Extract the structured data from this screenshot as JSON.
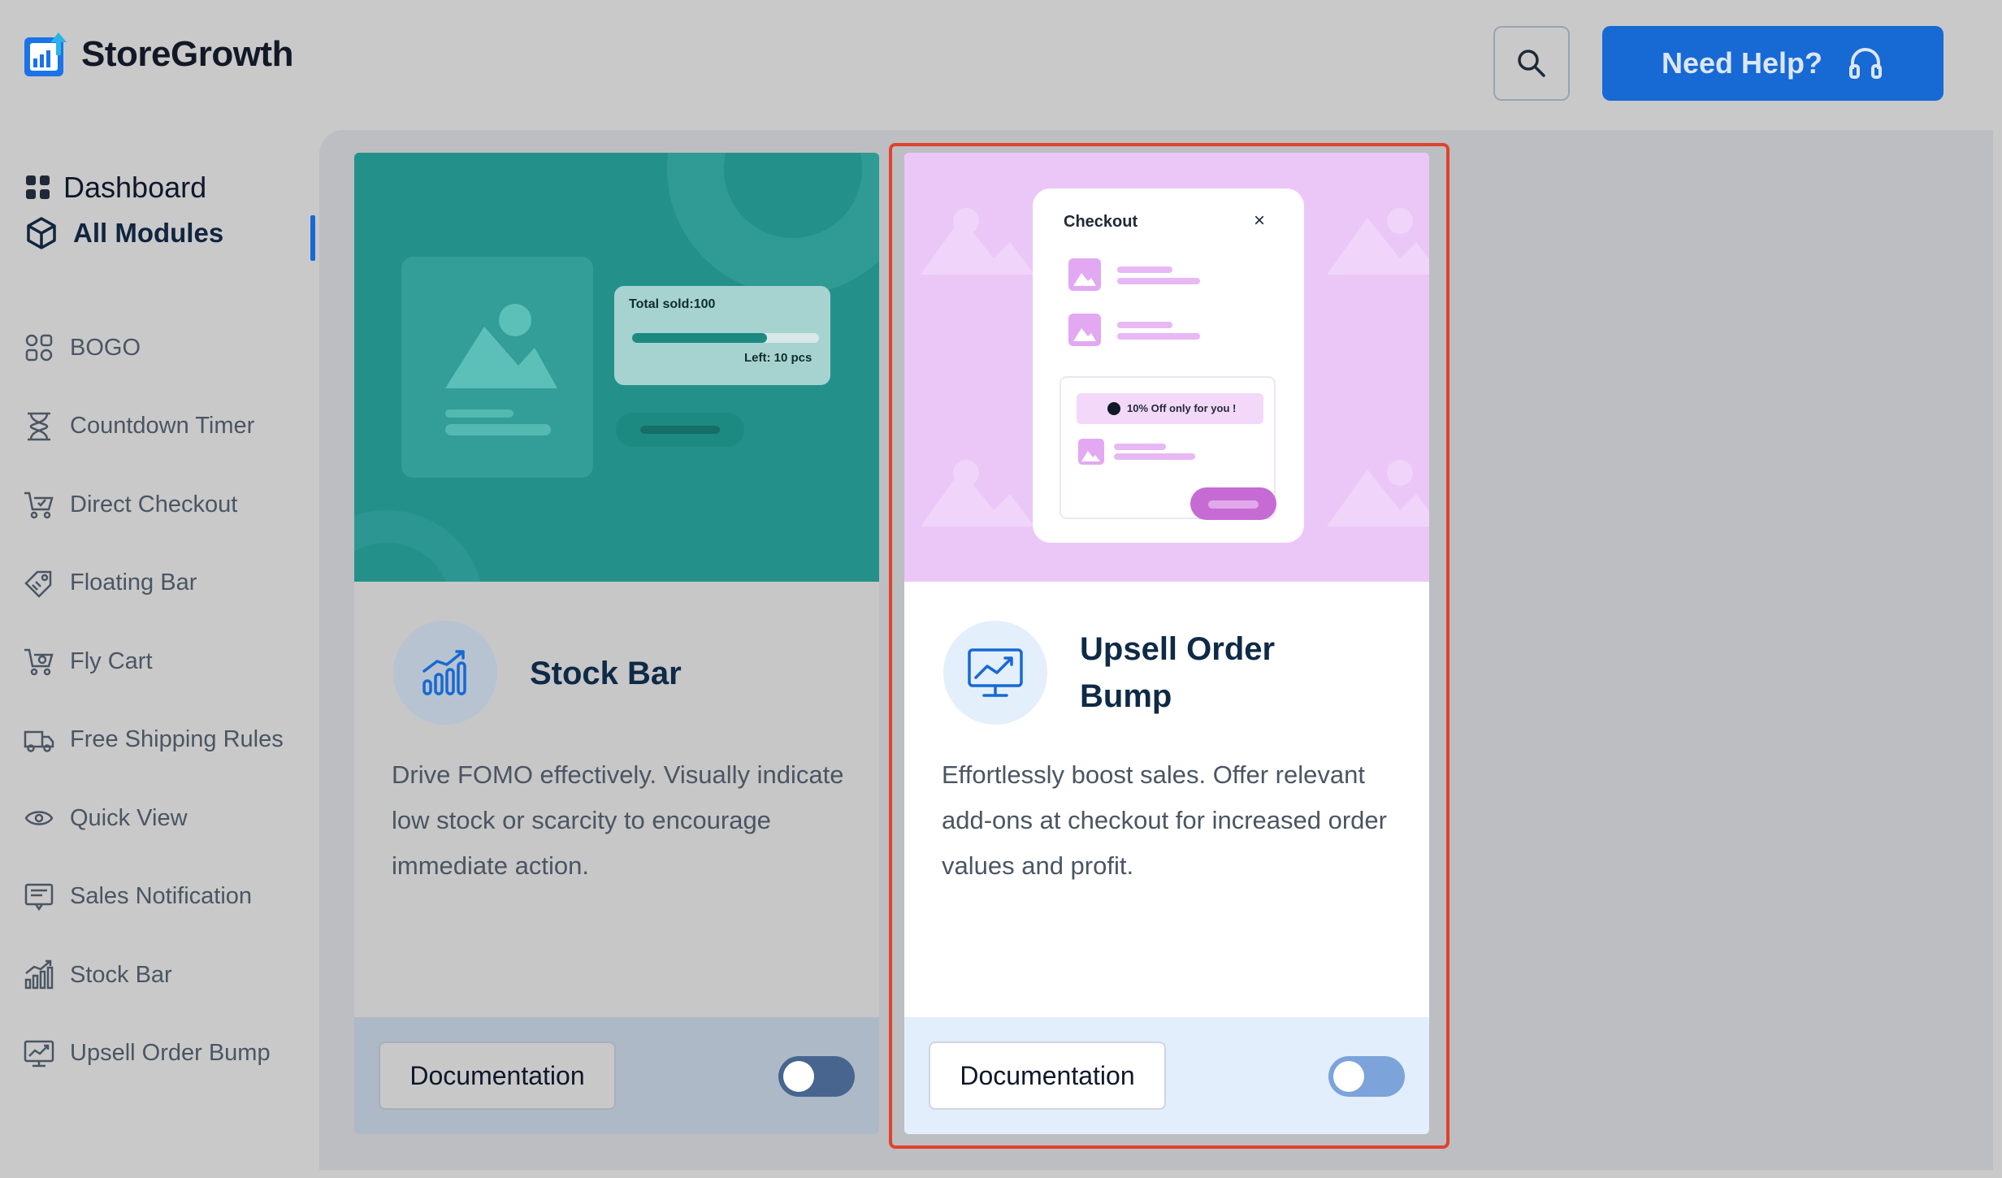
{
  "app": {
    "name": "StoreGrowth"
  },
  "header": {
    "search_icon": "search-icon",
    "help_label": "Need Help?",
    "help_icon": "headset-icon",
    "accent": "#1769d4"
  },
  "sidebar": {
    "dashboard": "Dashboard",
    "all_modules": "All Modules",
    "items": [
      {
        "label": "BOGO",
        "icon": "bogo-icon"
      },
      {
        "label": "Countdown Timer",
        "icon": "hourglass-icon"
      },
      {
        "label": "Direct Checkout",
        "icon": "cart-check-icon"
      },
      {
        "label": "Floating Bar",
        "icon": "tag-icon"
      },
      {
        "label": "Fly Cart",
        "icon": "cart-icon"
      },
      {
        "label": "Free Shipping Rules",
        "icon": "truck-icon"
      },
      {
        "label": "Quick View",
        "icon": "eye-icon"
      },
      {
        "label": "Sales Notification",
        "icon": "notification-icon"
      },
      {
        "label": "Stock Bar",
        "icon": "bar-chart-icon"
      },
      {
        "label": "Upsell Order Bump",
        "icon": "monitor-chart-icon"
      }
    ]
  },
  "cards": [
    {
      "title": "Stock Bar",
      "description": "Drive FOMO effectively. Visually indicate low stock or scarcity to encourage immediate action.",
      "doc_label": "Documentation",
      "enabled": false,
      "preview": {
        "total_sold": "Total sold:100",
        "left": "Left: 10 pcs",
        "progress": 0.72
      }
    },
    {
      "title": "Upsell Order Bump",
      "description": "Effortlessly boost sales. Offer relevant add-ons at checkout for increased order values and profit.",
      "doc_label": "Documentation",
      "enabled": false,
      "preview": {
        "checkout_title": "Checkout",
        "close": "×",
        "offer": "10% Off only for you !"
      }
    }
  ],
  "colors": {
    "highlight": "#e0422c",
    "stock_bar_bg": "#24908a",
    "upsell_bg": "#ebc7f7"
  }
}
